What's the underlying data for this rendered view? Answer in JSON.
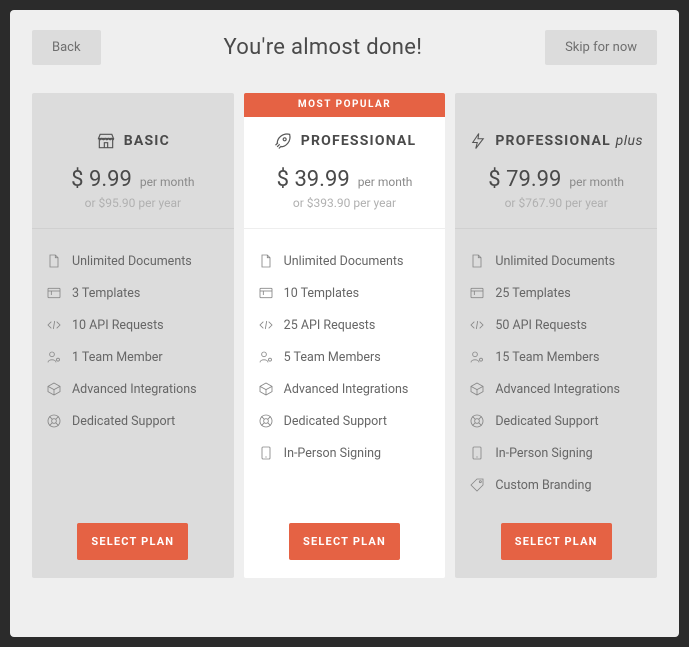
{
  "header": {
    "back": "Back",
    "title": "You're almost done!",
    "skip": "Skip for now"
  },
  "popular_badge": "MOST POPULAR",
  "select_label": "SELECT PLAN",
  "plans": [
    {
      "name": "BASIC",
      "price": "$ 9.99",
      "per": "per month",
      "year": "or $95.90 per year",
      "features": [
        "Unlimited Documents",
        "3 Templates",
        "10 API Requests",
        "1 Team Member",
        "Advanced Integrations",
        "Dedicated Support"
      ]
    },
    {
      "name": "PROFESSIONAL",
      "price": "$ 39.99",
      "per": "per month",
      "year": "or $393.90 per year",
      "features": [
        "Unlimited Documents",
        "10 Templates",
        "25 API Requests",
        "5 Team Members",
        "Advanced Integrations",
        "Dedicated Support",
        "In-Person Signing"
      ]
    },
    {
      "name": "PROFESSIONAL",
      "suffix": "plus",
      "price": "$ 79.99",
      "per": "per month",
      "year": "or $767.90 per year",
      "features": [
        "Unlimited Documents",
        "25 Templates",
        "50 API Requests",
        "15 Team Members",
        "Advanced Integrations",
        "Dedicated Support",
        "In-Person Signing",
        "Custom Branding"
      ]
    }
  ]
}
